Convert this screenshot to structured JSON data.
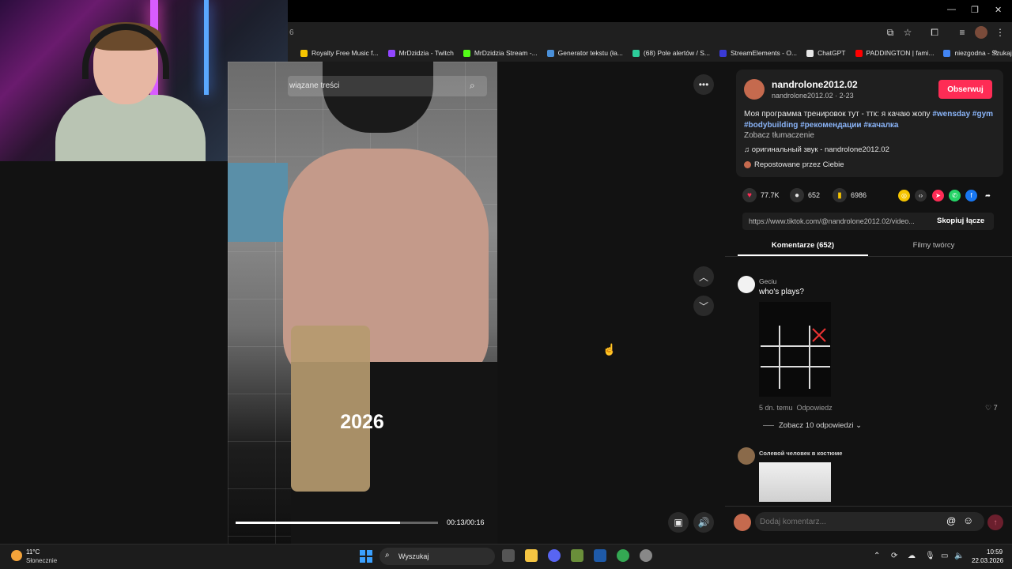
{
  "browser": {
    "url_fragment": "6",
    "bookmarks": [
      {
        "label": "Royalty Free Music f...",
        "color": "#f5c400"
      },
      {
        "label": "MrDzidzia - Twitch",
        "color": "#9146ff"
      },
      {
        "label": "MrDzidzia Stream -...",
        "color": "#53fc18"
      },
      {
        "label": "Generator tekstu (ła...",
        "color": "#4a90d9"
      },
      {
        "label": "(68) Pole alertów / S...",
        "color": "#2dcc9a"
      },
      {
        "label": "StreamElements - O...",
        "color": "#3a3ad6"
      },
      {
        "label": "ChatGPT",
        "color": "#e6e6e6"
      },
      {
        "label": "PADDINGTON | fami...",
        "color": "#ff0000"
      },
      {
        "label": "niezgodna - Szukaj...",
        "color": "#4285f4"
      }
    ],
    "more_bookmarks": "»"
  },
  "video": {
    "search_placeholder": "Powiązane treści",
    "search_visible_text": "wiązane treści",
    "overlay_text": "2026",
    "time": "00:13/00:16",
    "progress_fraction": 0.8125
  },
  "post": {
    "username": "nandrolone2012.02",
    "subline": "nandrolone2012.02 · 2-23",
    "follow_label": "Obserwuj",
    "description_text": "Моя программа тренировок тут - ттк: я качаю жопу ",
    "hashtags": [
      "#wensday",
      "#gym",
      "#bodybuilding",
      "#рекомендации",
      "#качалка"
    ],
    "translate_label": "Zobacz tłumaczenie",
    "sound": "оригинальный звук - nandrolone2012.02",
    "repost": "Repostowane przez Ciebie",
    "likes": "77.7K",
    "comments_count": "652",
    "saves": "6986",
    "link": "https://www.tiktok.com/@nandrolone2012.02/video...",
    "copy_link_label": "Skopiuj łącze",
    "share_icons": [
      {
        "name": "embed-icon",
        "color": "#f5c400"
      },
      {
        "name": "code-icon",
        "color": "#2f2f2f"
      },
      {
        "name": "send-friends-icon",
        "color": "#fe2c55"
      },
      {
        "name": "whatsapp-icon",
        "color": "#25d366"
      },
      {
        "name": "facebook-icon",
        "color": "#1877f2"
      }
    ]
  },
  "tabs": {
    "comments": "Komentarze (652)",
    "creator_videos": "Filmy twórcy"
  },
  "comments": [
    {
      "author": "Geciu",
      "text": "who's plays?",
      "meta_time": "5 dn. temu",
      "reply_label": "Odpowiedz",
      "likes": "7",
      "view_replies": "Zobacz 10 odpowiedzi"
    },
    {
      "author": "Солевой человек в костюме"
    }
  ],
  "comment_bar": {
    "placeholder": "Dodaj komentarz..."
  },
  "taskbar": {
    "weather_temp": "11°C",
    "weather_desc": "Słonecznie",
    "search_label": "Wyszukaj",
    "time": "10:59",
    "date": "22.03.2026"
  },
  "colors": {
    "accent": "#fe2c55",
    "hashtag": "#8ab4f8"
  }
}
